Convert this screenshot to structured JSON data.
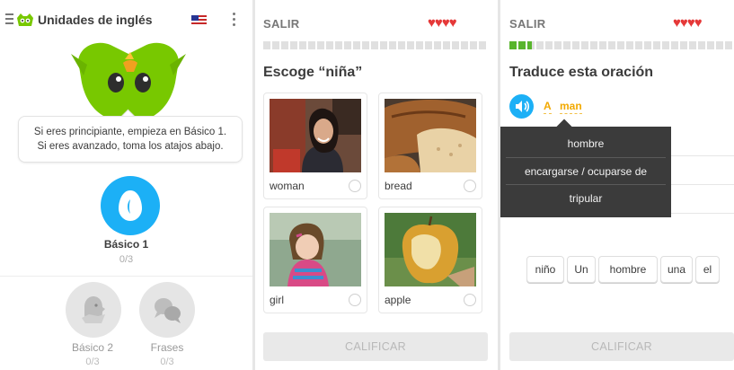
{
  "home": {
    "title": "Unidades de inglés",
    "bubble_line1": "Si eres principiante, empieza en Básico 1.",
    "bubble_line2": "Si eres avanzado, toma los atajos abajo.",
    "skills": [
      {
        "label": "Básico 1",
        "count": "0/3",
        "color": "#1cb0f6"
      },
      {
        "label": "Básico 2",
        "count": "0/3"
      },
      {
        "label": "Frases",
        "count": "0/3"
      }
    ],
    "icons": [
      "menu-icon",
      "owl-logo-icon",
      "us-flag-icon",
      "more-vert-icon"
    ]
  },
  "select_lesson": {
    "exit_label": "SALIR",
    "hearts": "♥♥♥♥",
    "progress": 0,
    "prompt": "Escoge “niña”",
    "options": [
      {
        "label": "woman"
      },
      {
        "label": "bread"
      },
      {
        "label": "girl"
      },
      {
        "label": "apple"
      }
    ],
    "check_label": "CALIFICAR"
  },
  "translate_lesson": {
    "exit_label": "SALIR",
    "hearts": "♥♥♥♥",
    "progress": 0.1,
    "prompt": "Traduce esta oración",
    "sentence_words": [
      "A",
      "man"
    ],
    "tooltip_options": [
      "hombre",
      "encargarse / ocuparse de",
      "tripular"
    ],
    "word_bank": [
      "niño",
      "Un",
      "hombre",
      "una",
      "el"
    ],
    "check_label": "CALIFICAR"
  },
  "colors": {
    "accent": "#1cb0f6",
    "owl_green": "#78c800",
    "heart": "#e53838",
    "progress_green": "#58b52c",
    "hint": "#f2a900"
  }
}
